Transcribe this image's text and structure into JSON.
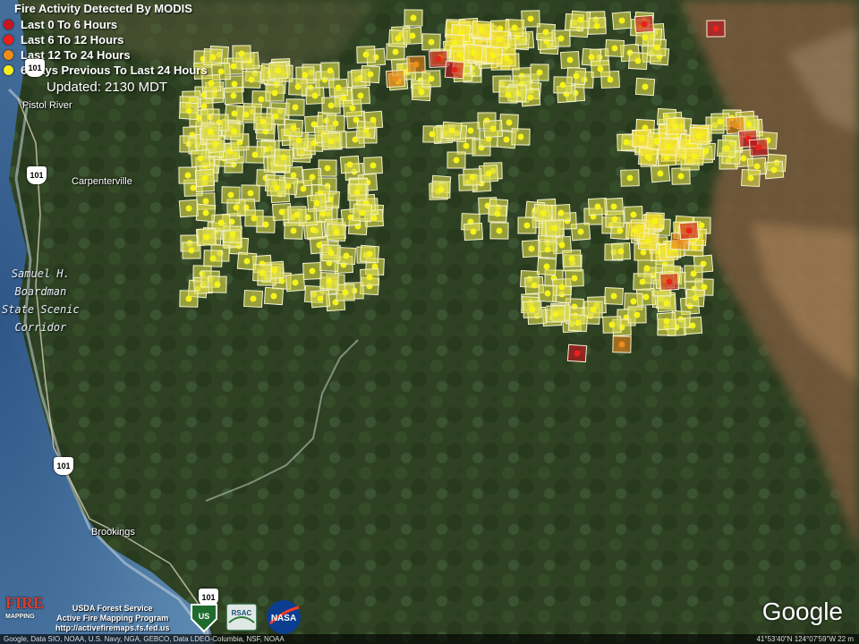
{
  "legend": {
    "title": "Fire Activity Detected By MODIS",
    "items": [
      {
        "label": "Last 0 To 6 Hours",
        "color": "#c8141e"
      },
      {
        "label": "Last 6 To 12 Hours",
        "color": "#e8221a"
      },
      {
        "label": "Last 12 To 24 Hours",
        "color": "#ef8c1a"
      },
      {
        "label": "6 Days Previous To Last 24 Hours",
        "color": "#f5ee1c"
      }
    ]
  },
  "updated": "Updated: 2130 MDT",
  "places": {
    "pistol_river": "Pistol River",
    "carpenterville": "Carpenterville",
    "brookings": "Brookings",
    "corridor": [
      "Samuel H.",
      "Boardman",
      "State Scenic",
      "Corridor"
    ]
  },
  "routes": {
    "r1": "101",
    "r2": "101",
    "r3": "101",
    "r4": "101"
  },
  "credits": {
    "line1": "USDA Forest Service",
    "line2": "Active Fire Mapping Program",
    "line3": "http://activefiremaps.fs.fed.us",
    "fire_logo": "FIRE",
    "fire_sub": "MAPPING",
    "usfs": "US",
    "rsac": "RSAC",
    "nasa": "NASA"
  },
  "google_logo": "Google",
  "footer": {
    "attribution": "Google, Data SIO, NOAA, U.S. Navy, NGA, GEBCO, Data LDEO-Columbia, NSF, NOAA",
    "coords": "41°53'40\"N 124°07'59\"W  22 m"
  },
  "colors": {
    "forest": "#2f4424",
    "ocean": "#3a5f86",
    "ridge": "#8a6a47"
  }
}
